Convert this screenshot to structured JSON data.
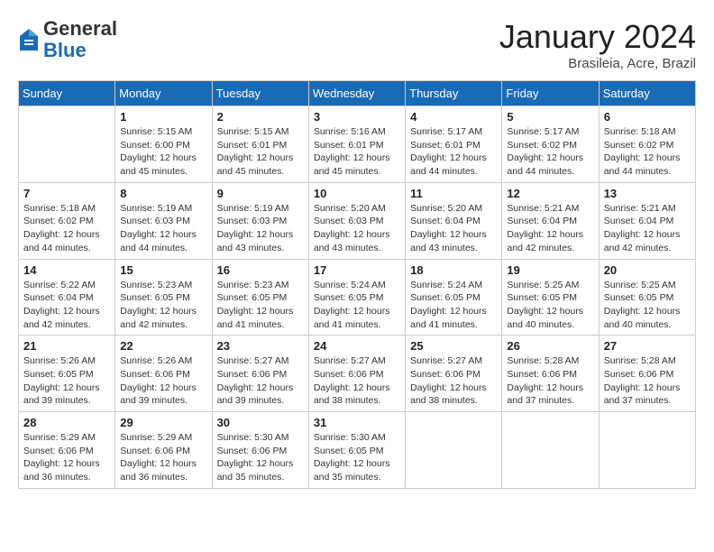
{
  "header": {
    "logo_general": "General",
    "logo_blue": "Blue",
    "month_title": "January 2024",
    "location": "Brasileia, Acre, Brazil"
  },
  "weekdays": [
    "Sunday",
    "Monday",
    "Tuesday",
    "Wednesday",
    "Thursday",
    "Friday",
    "Saturday"
  ],
  "weeks": [
    [
      {
        "day": "",
        "info": ""
      },
      {
        "day": "1",
        "info": "Sunrise: 5:15 AM\nSunset: 6:00 PM\nDaylight: 12 hours\nand 45 minutes."
      },
      {
        "day": "2",
        "info": "Sunrise: 5:15 AM\nSunset: 6:01 PM\nDaylight: 12 hours\nand 45 minutes."
      },
      {
        "day": "3",
        "info": "Sunrise: 5:16 AM\nSunset: 6:01 PM\nDaylight: 12 hours\nand 45 minutes."
      },
      {
        "day": "4",
        "info": "Sunrise: 5:17 AM\nSunset: 6:01 PM\nDaylight: 12 hours\nand 44 minutes."
      },
      {
        "day": "5",
        "info": "Sunrise: 5:17 AM\nSunset: 6:02 PM\nDaylight: 12 hours\nand 44 minutes."
      },
      {
        "day": "6",
        "info": "Sunrise: 5:18 AM\nSunset: 6:02 PM\nDaylight: 12 hours\nand 44 minutes."
      }
    ],
    [
      {
        "day": "7",
        "info": "Sunrise: 5:18 AM\nSunset: 6:02 PM\nDaylight: 12 hours\nand 44 minutes."
      },
      {
        "day": "8",
        "info": "Sunrise: 5:19 AM\nSunset: 6:03 PM\nDaylight: 12 hours\nand 44 minutes."
      },
      {
        "day": "9",
        "info": "Sunrise: 5:19 AM\nSunset: 6:03 PM\nDaylight: 12 hours\nand 43 minutes."
      },
      {
        "day": "10",
        "info": "Sunrise: 5:20 AM\nSunset: 6:03 PM\nDaylight: 12 hours\nand 43 minutes."
      },
      {
        "day": "11",
        "info": "Sunrise: 5:20 AM\nSunset: 6:04 PM\nDaylight: 12 hours\nand 43 minutes."
      },
      {
        "day": "12",
        "info": "Sunrise: 5:21 AM\nSunset: 6:04 PM\nDaylight: 12 hours\nand 42 minutes."
      },
      {
        "day": "13",
        "info": "Sunrise: 5:21 AM\nSunset: 6:04 PM\nDaylight: 12 hours\nand 42 minutes."
      }
    ],
    [
      {
        "day": "14",
        "info": "Sunrise: 5:22 AM\nSunset: 6:04 PM\nDaylight: 12 hours\nand 42 minutes."
      },
      {
        "day": "15",
        "info": "Sunrise: 5:23 AM\nSunset: 6:05 PM\nDaylight: 12 hours\nand 42 minutes."
      },
      {
        "day": "16",
        "info": "Sunrise: 5:23 AM\nSunset: 6:05 PM\nDaylight: 12 hours\nand 41 minutes."
      },
      {
        "day": "17",
        "info": "Sunrise: 5:24 AM\nSunset: 6:05 PM\nDaylight: 12 hours\nand 41 minutes."
      },
      {
        "day": "18",
        "info": "Sunrise: 5:24 AM\nSunset: 6:05 PM\nDaylight: 12 hours\nand 41 minutes."
      },
      {
        "day": "19",
        "info": "Sunrise: 5:25 AM\nSunset: 6:05 PM\nDaylight: 12 hours\nand 40 minutes."
      },
      {
        "day": "20",
        "info": "Sunrise: 5:25 AM\nSunset: 6:05 PM\nDaylight: 12 hours\nand 40 minutes."
      }
    ],
    [
      {
        "day": "21",
        "info": "Sunrise: 5:26 AM\nSunset: 6:05 PM\nDaylight: 12 hours\nand 39 minutes."
      },
      {
        "day": "22",
        "info": "Sunrise: 5:26 AM\nSunset: 6:06 PM\nDaylight: 12 hours\nand 39 minutes."
      },
      {
        "day": "23",
        "info": "Sunrise: 5:27 AM\nSunset: 6:06 PM\nDaylight: 12 hours\nand 39 minutes."
      },
      {
        "day": "24",
        "info": "Sunrise: 5:27 AM\nSunset: 6:06 PM\nDaylight: 12 hours\nand 38 minutes."
      },
      {
        "day": "25",
        "info": "Sunrise: 5:27 AM\nSunset: 6:06 PM\nDaylight: 12 hours\nand 38 minutes."
      },
      {
        "day": "26",
        "info": "Sunrise: 5:28 AM\nSunset: 6:06 PM\nDaylight: 12 hours\nand 37 minutes."
      },
      {
        "day": "27",
        "info": "Sunrise: 5:28 AM\nSunset: 6:06 PM\nDaylight: 12 hours\nand 37 minutes."
      }
    ],
    [
      {
        "day": "28",
        "info": "Sunrise: 5:29 AM\nSunset: 6:06 PM\nDaylight: 12 hours\nand 36 minutes."
      },
      {
        "day": "29",
        "info": "Sunrise: 5:29 AM\nSunset: 6:06 PM\nDaylight: 12 hours\nand 36 minutes."
      },
      {
        "day": "30",
        "info": "Sunrise: 5:30 AM\nSunset: 6:06 PM\nDaylight: 12 hours\nand 35 minutes."
      },
      {
        "day": "31",
        "info": "Sunrise: 5:30 AM\nSunset: 6:05 PM\nDaylight: 12 hours\nand 35 minutes."
      },
      {
        "day": "",
        "info": ""
      },
      {
        "day": "",
        "info": ""
      },
      {
        "day": "",
        "info": ""
      }
    ]
  ]
}
